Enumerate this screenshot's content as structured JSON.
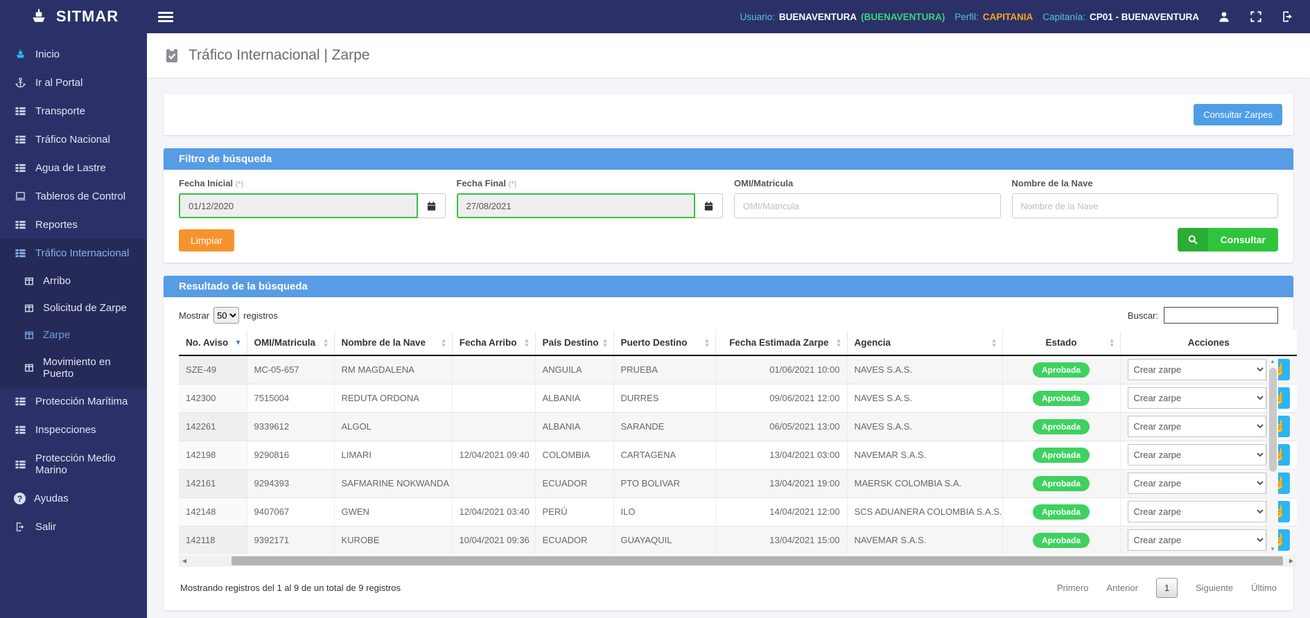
{
  "app": {
    "brand": "SITMAR"
  },
  "topbar": {
    "usuario_label": "Usuario:",
    "usuario_value": "BUENAVENTURA",
    "usuario_paren": "(BUENAVENTURA)",
    "perfil_label": "Perfil:",
    "perfil_value": "CAPITANIA",
    "capitania_label": "Capitanía:",
    "capitania_value": "CP01 - BUENAVENTURA"
  },
  "sidebar": {
    "items": [
      {
        "label": "Inicio",
        "icon": "ship-icon"
      },
      {
        "label": "Ir al Portal",
        "icon": "anchor-icon"
      },
      {
        "label": "Transporte",
        "icon": "table-icon"
      },
      {
        "label": "Tráfico Nacional",
        "icon": "table-icon"
      },
      {
        "label": "Agua de Lastre",
        "icon": "table-icon"
      },
      {
        "label": "Tableros de Control",
        "icon": "laptop-icon"
      },
      {
        "label": "Reportes",
        "icon": "table-icon"
      },
      {
        "label": "Tráfico Internacional",
        "icon": "table-icon",
        "active": true
      },
      {
        "label": "Protección Marítima",
        "icon": "table-icon"
      },
      {
        "label": "Inspecciones",
        "icon": "table-icon"
      },
      {
        "label": "Protección Medio Marino",
        "icon": "table-icon"
      },
      {
        "label": "Ayudas",
        "icon": "question-icon"
      },
      {
        "label": "Salir",
        "icon": "logout-icon"
      }
    ],
    "submenu": [
      {
        "label": "Arribo"
      },
      {
        "label": "Solicitud de Zarpe"
      },
      {
        "label": "Zarpe",
        "active": true
      },
      {
        "label": "Movimiento en Puerto"
      }
    ]
  },
  "page": {
    "title": "Tráfico Internacional | Zarpe"
  },
  "actions_bar": {
    "consultar_zarpes": "Consultar Zarpes"
  },
  "filter": {
    "title": "Filtro de búsqueda",
    "required_mark": "(*)",
    "fecha_inicial_label": "Fecha Inicial",
    "fecha_inicial_value": "01/12/2020",
    "fecha_final_label": "Fecha Final",
    "fecha_final_value": "27/08/2021",
    "omi_label": "OMI/Matricula",
    "omi_placeholder": "OMI/Matricula",
    "nave_label": "Nombre de la Nave",
    "nave_placeholder": "Nombre de la Nave",
    "limpiar": "Limpiar",
    "consultar": "Consultar"
  },
  "results": {
    "title": "Resultado de la búsqueda",
    "mostrar_label": "Mostrar",
    "page_size": "50",
    "registros_label": "registros",
    "buscar_label": "Buscar:",
    "columns": [
      "No. Aviso",
      "OMI/Matricula",
      "Nombre de la Nave",
      "Fecha Arribo",
      "País Destino",
      "Puerto Destino",
      "Fecha Estimada Zarpe",
      "Agencia",
      "Estado",
      "Acciones"
    ],
    "rows": [
      [
        "SZE-49",
        "MC-05-657",
        "RM MAGDALENA",
        "",
        "ANGUILA",
        "PRUEBA",
        "01/06/2021 10:00",
        "NAVES S.A.S.",
        "Aprobada",
        "Crear zarpe"
      ],
      [
        "142300",
        "7515004",
        "REDUTA ORDONA",
        "",
        "ALBANIA",
        "DURRES",
        "09/06/2021 12:00",
        "NAVES S.A.S.",
        "Aprobada",
        "Crear zarpe"
      ],
      [
        "142261",
        "9339612",
        "ALGOL",
        "",
        "ALBANIA",
        "SARANDE",
        "06/05/2021 13:00",
        "NAVES S.A.S.",
        "Aprobada",
        "Crear zarpe"
      ],
      [
        "142198",
        "9290816",
        "LIMARI",
        "12/04/2021 09:40",
        "COLOMBIA",
        "CARTAGENA",
        "13/04/2021 03:00",
        "NAVEMAR S.A.S.",
        "Aprobada",
        "Crear zarpe"
      ],
      [
        "142161",
        "9294393",
        "SAFMARINE NOKWANDA",
        "",
        "ECUADOR",
        "PTO BOLIVAR",
        "13/04/2021 19:00",
        "MAERSK COLOMBIA S.A.",
        "Aprobada",
        "Crear zarpe"
      ],
      [
        "142148",
        "9407067",
        "GWEN",
        "12/04/2021 03:40",
        "PERÚ",
        "ILO",
        "14/04/2021 12:00",
        "SCS ADUANERA COLOMBIA S.A.S.",
        "Aprobada",
        "Crear zarpe"
      ],
      [
        "142118",
        "9392171",
        "KUROBE",
        "10/04/2021 09:36",
        "ECUADOR",
        "GUAYAQUIL",
        "13/04/2021 15:00",
        "NAVEMAR S.A.S.",
        "Aprobada",
        "Crear zarpe"
      ]
    ],
    "footer_info": "Mostrando registros del 1 al 9 de un total de 9 registros",
    "pagination": {
      "primero": "Primero",
      "anterior": "Anterior",
      "page": "1",
      "siguiente": "Siguiente",
      "ultimo": "Último"
    }
  },
  "colors": {
    "navy": "#2b3168",
    "submenu_navy": "#252a58",
    "section_header_blue": "#579ce4",
    "approved_green": "#3fd160",
    "action_blue": "#2ab6f4",
    "limpiar_orange": "#f6932e",
    "consultar_green": "#2ec53b",
    "date_border_green": "#35c242"
  }
}
